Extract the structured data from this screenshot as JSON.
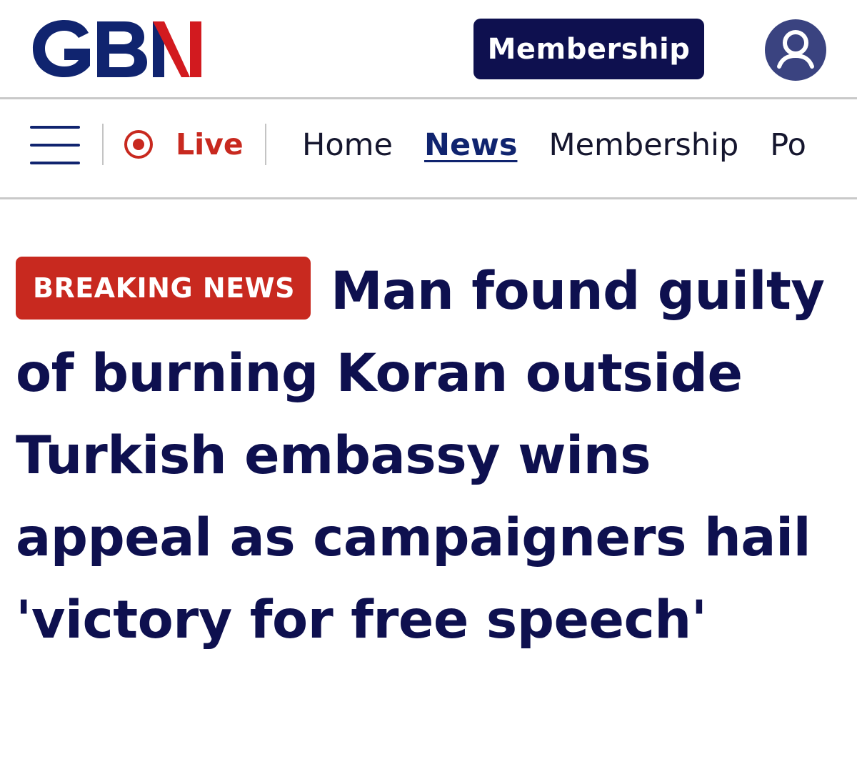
{
  "brand": {
    "name": "GBN",
    "navy": "#10246f",
    "red": "#d21a1f",
    "dark_navy": "#0e104f"
  },
  "header": {
    "membership_label": "Membership",
    "avatar_icon": "user-avatar-icon"
  },
  "nav": {
    "menu_icon": "hamburger-menu-icon",
    "live_icon": "live-record-icon",
    "live_label": "Live",
    "links": [
      {
        "label": "Home",
        "active": false
      },
      {
        "label": "News",
        "active": true
      },
      {
        "label": "Membership",
        "active": false
      },
      {
        "label": "Po",
        "active": false
      }
    ]
  },
  "article": {
    "badge": "BREAKING NEWS",
    "badge_color": "#c8291f",
    "headline": "Man found guilty of burning Koran outside Turkish embassy wins appeal as campaigners hail 'victory for free speech'"
  }
}
